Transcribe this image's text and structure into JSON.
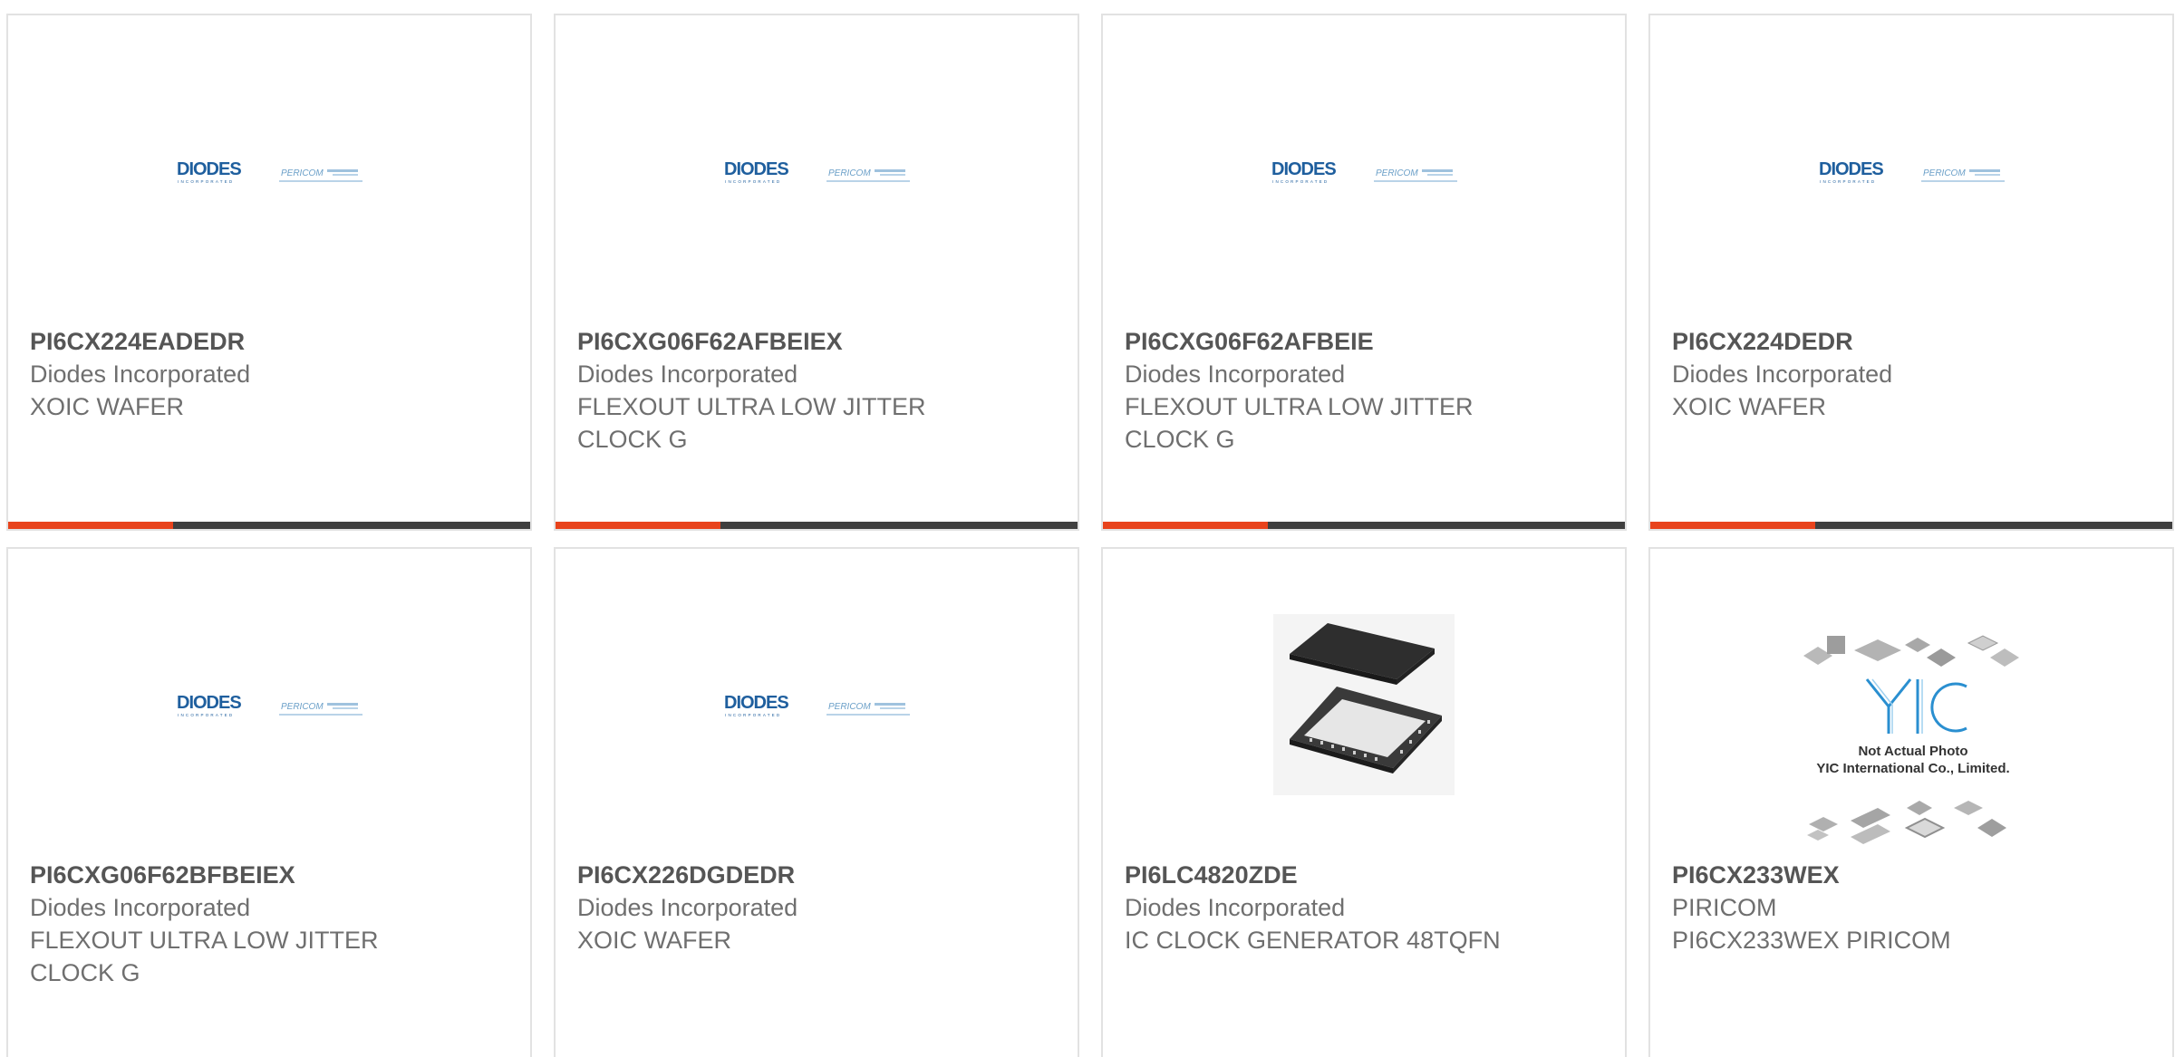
{
  "logos": {
    "diodes_text": "DIODES",
    "diodes_sub": "INCORPORATED",
    "pericom_text": "PERICOM"
  },
  "yic_image": {
    "line1": "Not Actual Photo",
    "line2": "YIC International Co., Limited.",
    "mark": "YIC"
  },
  "products": [
    {
      "part": "PI6CX224EADEDR",
      "manufacturer": "Diodes Incorporated",
      "description": "XOIC WAFER",
      "image": "diodes-logo"
    },
    {
      "part": "PI6CXG06F62AFBEIEX",
      "manufacturer": "Diodes Incorporated",
      "description": "FLEXOUT ULTRA LOW JITTER CLOCK G",
      "image": "diodes-logo"
    },
    {
      "part": "PI6CXG06F62AFBEIE",
      "manufacturer": "Diodes Incorporated",
      "description": "FLEXOUT ULTRA LOW JITTER CLOCK G",
      "image": "diodes-logo"
    },
    {
      "part": "PI6CX224DEDR",
      "manufacturer": "Diodes Incorporated",
      "description": "XOIC WAFER",
      "image": "diodes-logo"
    },
    {
      "part": "PI6CXG06F62BFBEIEX",
      "manufacturer": "Diodes Incorporated",
      "description": "FLEXOUT ULTRA LOW JITTER CLOCK G",
      "image": "diodes-logo"
    },
    {
      "part": "PI6CX226DGDEDR",
      "manufacturer": "Diodes Incorporated",
      "description": "XOIC WAFER",
      "image": "diodes-logo"
    },
    {
      "part": "PI6LC4820ZDE",
      "manufacturer": "Diodes Incorporated",
      "description": "IC CLOCK GENERATOR 48TQFN",
      "image": "qfn-chip"
    },
    {
      "part": "PI6CX233WEX",
      "manufacturer": "PIRICOM",
      "description": "PI6CX233WEX PIRICOM",
      "image": "yic-placeholder"
    }
  ],
  "colors": {
    "accent": "#e8431c",
    "bar": "#3f3f3f",
    "diodes_blue": "#1f5f9e",
    "pericom_blue": "#6a9fc8"
  }
}
